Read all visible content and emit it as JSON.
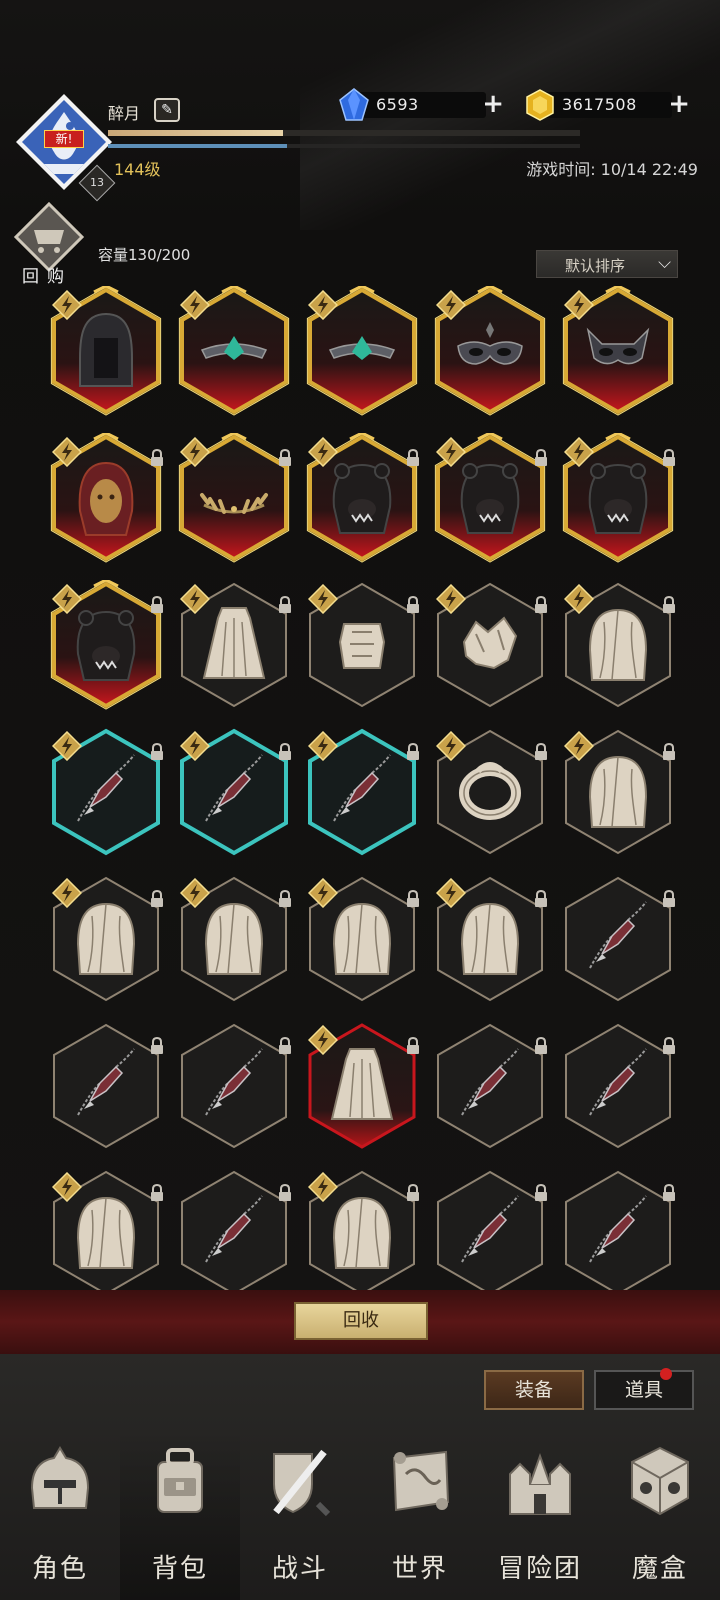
{
  "player": {
    "name": "醉月",
    "level": "144级",
    "vip_level": "13",
    "avatar_badge": "新!",
    "exp_progress": 0.37,
    "mp_progress": 0.38
  },
  "currency": {
    "diamonds": "6593",
    "gold": "3617508"
  },
  "game_time": "游戏时间: 10/14 22:49",
  "bag": {
    "rebuy_label": "回购",
    "capacity": "容量130/200",
    "sort_label": "默认排序"
  },
  "items": [
    {
      "icon": "dark-hood-icon",
      "rarity": "legendary",
      "locked": false
    },
    {
      "icon": "jade-circlet-icon",
      "rarity": "legendary",
      "locked": false
    },
    {
      "icon": "jade-circlet-icon",
      "rarity": "legendary",
      "locked": false
    },
    {
      "icon": "masquerade-mask-icon",
      "rarity": "legendary",
      "locked": false
    },
    {
      "icon": "horned-mask-icon",
      "rarity": "legendary",
      "locked": false
    },
    {
      "icon": "lion-helm-icon",
      "rarity": "legendary",
      "locked": true
    },
    {
      "icon": "laurel-crown-icon",
      "rarity": "legendary",
      "locked": true
    },
    {
      "icon": "bear-helm-icon",
      "rarity": "legendary",
      "locked": true
    },
    {
      "icon": "bear-helm-icon",
      "rarity": "legendary",
      "locked": true
    },
    {
      "icon": "bear-helm-icon",
      "rarity": "legendary",
      "locked": true
    },
    {
      "icon": "bear-helm-icon",
      "rarity": "legendary",
      "locked": true
    },
    {
      "icon": "cloth-robe-icon",
      "rarity": "common",
      "locked": true
    },
    {
      "icon": "chest-armor-icon",
      "rarity": "common",
      "locked": true
    },
    {
      "icon": "shoulder-armor-icon",
      "rarity": "common",
      "locked": true
    },
    {
      "icon": "cloth-hood-icon",
      "rarity": "common",
      "locked": true
    },
    {
      "icon": "chain-dagger-icon",
      "rarity": "rare",
      "locked": true
    },
    {
      "icon": "chain-dagger-icon",
      "rarity": "rare",
      "locked": true
    },
    {
      "icon": "chain-dagger-icon",
      "rarity": "rare",
      "locked": true
    },
    {
      "icon": "ring-icon",
      "rarity": "common",
      "locked": true
    },
    {
      "icon": "cloth-hood-icon",
      "rarity": "common",
      "locked": true
    },
    {
      "icon": "cloth-hood-icon",
      "rarity": "common",
      "locked": true
    },
    {
      "icon": "cloth-hood-icon",
      "rarity": "common",
      "locked": true
    },
    {
      "icon": "cloth-hood-icon",
      "rarity": "common",
      "locked": true
    },
    {
      "icon": "cloth-hood-icon",
      "rarity": "common",
      "locked": true
    },
    {
      "icon": "chain-dagger-icon",
      "rarity": "common",
      "locked": true,
      "nobadge": true
    },
    {
      "icon": "chain-dagger-icon",
      "rarity": "common",
      "locked": true,
      "nobadge": true
    },
    {
      "icon": "chain-dagger-icon",
      "rarity": "common",
      "locked": true,
      "nobadge": true
    },
    {
      "icon": "cloth-robe-icon",
      "rarity": "epic",
      "locked": true
    },
    {
      "icon": "chain-dagger-icon",
      "rarity": "common",
      "locked": true,
      "nobadge": true
    },
    {
      "icon": "chain-dagger-icon",
      "rarity": "common",
      "locked": true,
      "nobadge": true
    },
    {
      "icon": "cloth-hood-icon",
      "rarity": "common",
      "locked": true
    },
    {
      "icon": "chain-dagger-icon",
      "rarity": "common",
      "locked": true,
      "nobadge": true
    },
    {
      "icon": "cloth-hood-icon",
      "rarity": "common",
      "locked": true
    },
    {
      "icon": "chain-dagger-icon",
      "rarity": "common",
      "locked": true,
      "nobadge": true
    },
    {
      "icon": "chain-dagger-icon",
      "rarity": "common",
      "locked": true,
      "nobadge": true
    }
  ],
  "actions": {
    "recycle": "回收"
  },
  "tabs": {
    "equipment": "装备",
    "props": "道具"
  },
  "nav": [
    {
      "label": "角色",
      "icon": "helmet-icon"
    },
    {
      "label": "背包",
      "icon": "backpack-icon",
      "active": true
    },
    {
      "label": "战斗",
      "icon": "sword-shield-icon"
    },
    {
      "label": "世界",
      "icon": "map-scroll-icon"
    },
    {
      "label": "冒险团",
      "icon": "castle-icon"
    },
    {
      "label": "魔盒",
      "icon": "magic-cube-icon"
    }
  ],
  "colors": {
    "legendary": "#d8a935",
    "legendary_glow": "#c8161d",
    "rare": "#3cc4be",
    "epic": "#c8161d",
    "common": "#b7ab97",
    "accent_gold": "#e2c15a"
  }
}
